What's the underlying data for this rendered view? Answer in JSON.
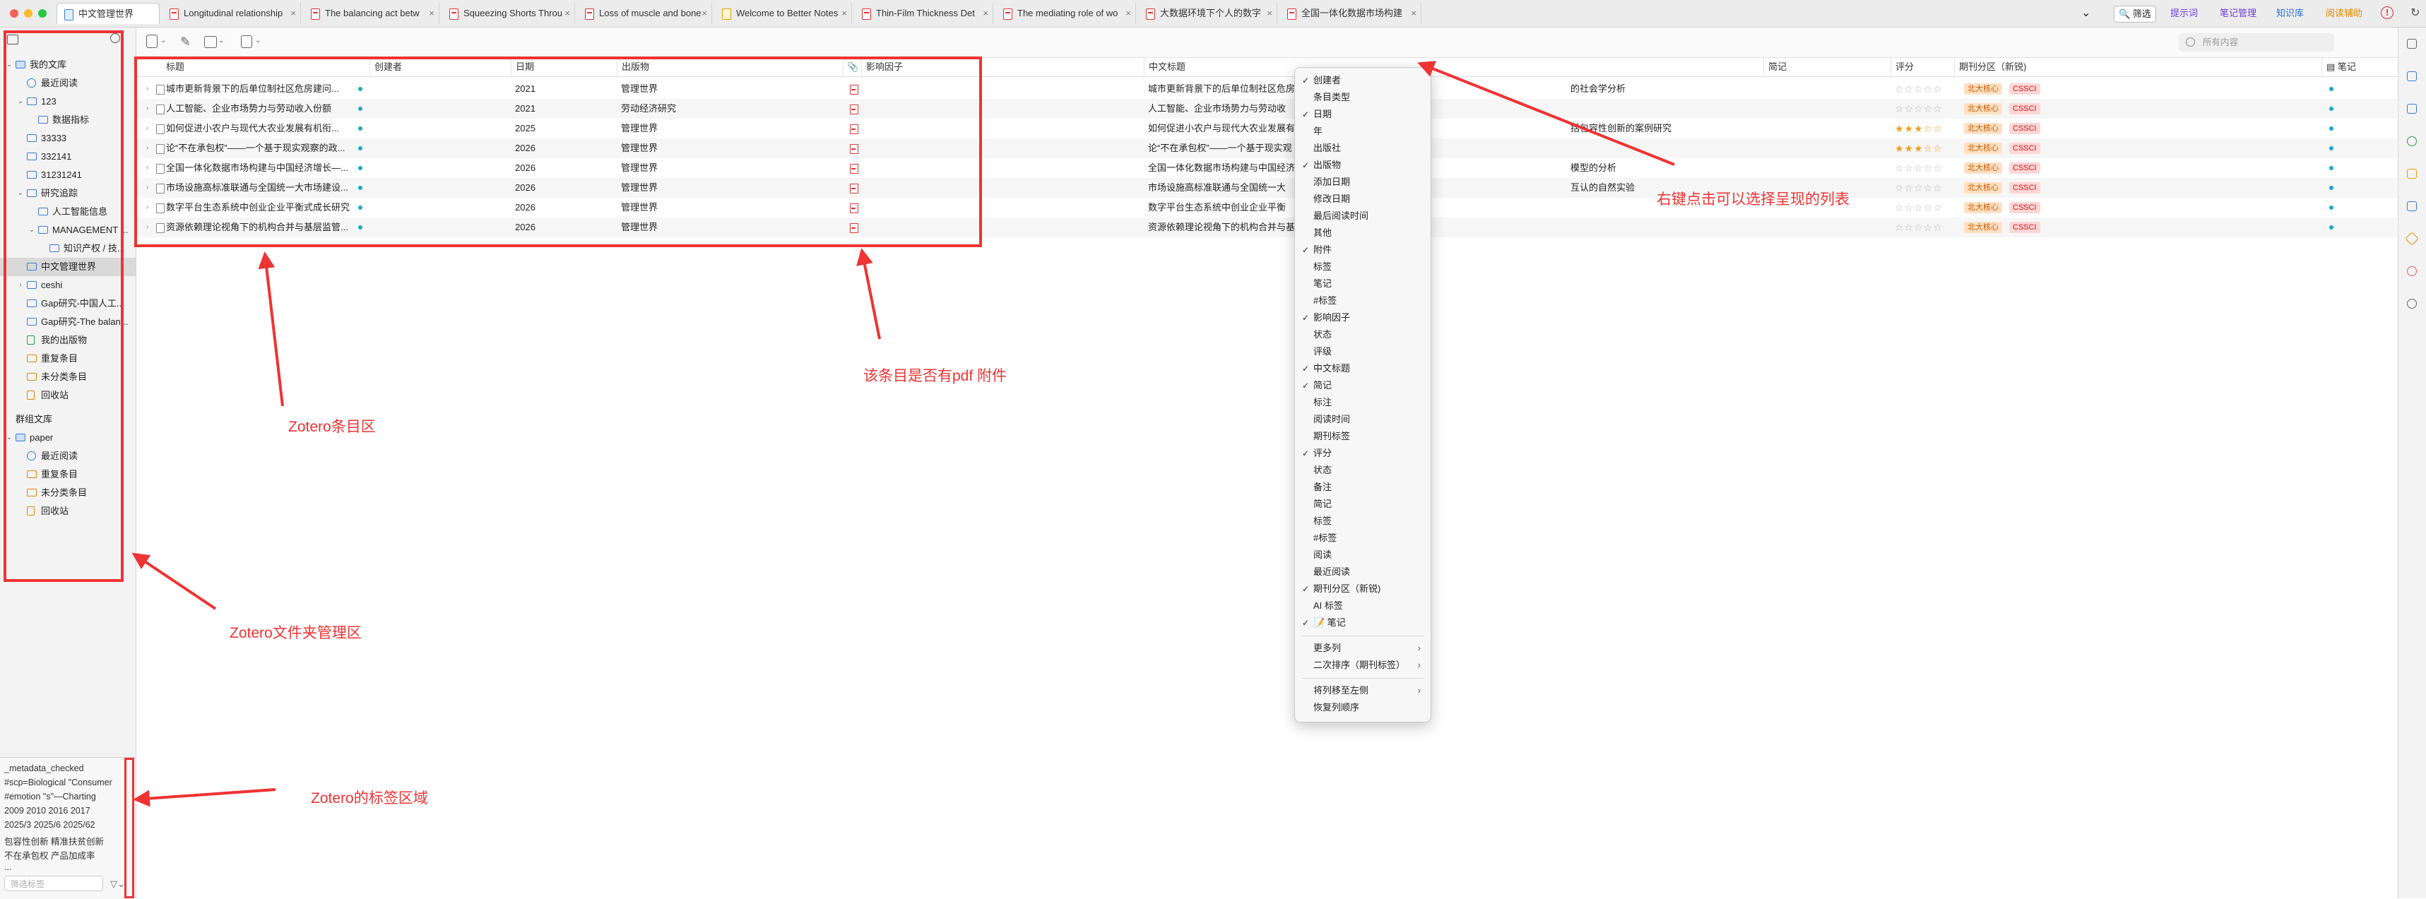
{
  "colors": {
    "annotation": "#ee3333",
    "accent": "#3a7bd5",
    "selected_row": "#d9d9d9",
    "star": "#f0a020",
    "dot": "#1aa8c7",
    "badge_orange_bg": "#ffe0c2",
    "badge_red_bg": "#ffd6d6"
  },
  "tabs": [
    {
      "label": "中文管理世界",
      "icon": "library-icon"
    },
    {
      "label": "Longitudinal relationship",
      "icon": "pdf-icon"
    },
    {
      "label": "The balancing act betw",
      "icon": "pdf-icon"
    },
    {
      "label": "Squeezing Shorts Throu",
      "icon": "pdf-icon"
    },
    {
      "label": "Loss of muscle and bone",
      "icon": "pdf-icon"
    },
    {
      "label": "Welcome to Better Notes",
      "icon": "note-icon"
    },
    {
      "label": "Thin-Film Thickness Det",
      "icon": "pdf-icon"
    },
    {
      "label": "The mediating role of wo",
      "icon": "pdf-icon"
    },
    {
      "label": "大数据环境下个人的数字",
      "icon": "pdf-icon"
    },
    {
      "label": "全国一体化数据市场构建",
      "icon": "pdf-icon"
    }
  ],
  "tab_close": "×",
  "tab_dropdown": "⌄",
  "toolbar_right": {
    "filter": "筛选",
    "prompt": "提示词",
    "notes_mgmt": "笔记管理",
    "kb": "知识库",
    "reading": "阅读辅助",
    "alert": "!",
    "sync": "↻"
  },
  "search": {
    "placeholder": "所有内容"
  },
  "library_tree": [
    {
      "label": "我的文库",
      "depth": 0,
      "twisty": "⌄",
      "icon": "library"
    },
    {
      "label": "最近阅读",
      "depth": 1,
      "twisty": "",
      "icon": "clock"
    },
    {
      "label": "123",
      "depth": 1,
      "twisty": "⌄",
      "icon": "folder"
    },
    {
      "label": "数据指标",
      "depth": 2,
      "twisty": "",
      "icon": "folder"
    },
    {
      "label": "33333",
      "depth": 1,
      "twisty": "",
      "icon": "folder"
    },
    {
      "label": "332141",
      "depth": 1,
      "twisty": "",
      "icon": "folder"
    },
    {
      "label": "31231241",
      "depth": 1,
      "twisty": "",
      "icon": "folder"
    },
    {
      "label": "研究追踪",
      "depth": 1,
      "twisty": "⌄",
      "icon": "folder"
    },
    {
      "label": "人工智能信息",
      "depth": 2,
      "twisty": "",
      "icon": "folder"
    },
    {
      "label": "MANAGEMENT ...",
      "depth": 2,
      "twisty": "⌄",
      "icon": "folder"
    },
    {
      "label": "知识产权 / 技...",
      "depth": 3,
      "twisty": "",
      "icon": "folder"
    },
    {
      "label": "中文管理世界",
      "depth": 1,
      "twisty": "",
      "icon": "folder",
      "selected": true
    },
    {
      "label": "ceshi",
      "depth": 1,
      "twisty": "›",
      "icon": "folder"
    },
    {
      "label": "Gap研究-中国人工...",
      "depth": 1,
      "twisty": "",
      "icon": "folder"
    },
    {
      "label": "Gap研究-The balan...",
      "depth": 1,
      "twisty": "",
      "icon": "folder"
    },
    {
      "label": "我的出版物",
      "depth": 1,
      "twisty": "",
      "icon": "pub"
    },
    {
      "label": "重复条目",
      "depth": 1,
      "twisty": "",
      "icon": "dup"
    },
    {
      "label": "未分类条目",
      "depth": 1,
      "twisty": "",
      "icon": "unfiled"
    },
    {
      "label": "回收站",
      "depth": 1,
      "twisty": "",
      "icon": "trash"
    },
    {
      "label": "群组文库",
      "depth": 0,
      "twisty": "",
      "icon": "none"
    },
    {
      "label": "paper",
      "depth": 0,
      "twisty": "⌄",
      "icon": "group"
    },
    {
      "label": "最近阅读",
      "depth": 1,
      "twisty": "",
      "icon": "clock"
    },
    {
      "label": "重复条目",
      "depth": 1,
      "twisty": "",
      "icon": "dup"
    },
    {
      "label": "未分类条目",
      "depth": 1,
      "twisty": "",
      "icon": "unfiled"
    },
    {
      "label": "回收站",
      "depth": 1,
      "twisty": "",
      "icon": "trash"
    }
  ],
  "tags": {
    "lines": [
      "_metadata_checked",
      "#scp=Biological  \"Consumer",
      "#emotion   \"s\"—Charting",
      "2009   2010   2016   2017",
      "2025/3   2025/6   2025/62",
      "包容性创新   精准扶贫创新",
      "不在承包权   产品加成率",
      "..."
    ],
    "filter_placeholder": "筛选标签"
  },
  "table": {
    "columns": {
      "title": "标题",
      "creator": "创建者",
      "date": "日期",
      "publication": "出版物",
      "attachment": "📎",
      "impact": "影响因子",
      "cn_title": "中文标题",
      "abstract": "简记",
      "rating": "评分",
      "journal_zone": "期刊分区（新锐)",
      "notes": "笔记"
    },
    "rows": [
      {
        "title": "城市更新背景下的后单位制社区危房建问...",
        "date": "2021",
        "publication": "管理世界",
        "cn_title": "城市更新背景下的后单位制社区危房建问...",
        "cn_tail": "的社会学分析",
        "stars": "☆☆☆☆☆",
        "rating_count": 0,
        "badges": [
          "北大核心",
          "CSSCI"
        ]
      },
      {
        "title": "人工智能、企业市场势力与劳动收入份额",
        "date": "2021",
        "publication": "劳动经济研究",
        "cn_title": "人工智能、企业市场势力与劳动收",
        "cn_tail": "",
        "stars": "☆☆☆☆☆",
        "rating_count": 0,
        "badges": [
          "北大核心",
          "CSSCI"
        ]
      },
      {
        "title": "如何促进小农户与现代大农业发展有机衔...",
        "date": "2025",
        "publication": "管理世界",
        "cn_title": "如何促进小农户与现代大农业发展有机衔",
        "cn_tail": "括包容性创新的案例研究",
        "stars": "★★★☆☆",
        "rating_count": 3,
        "badges": [
          "北大核心",
          "CSSCI"
        ]
      },
      {
        "title": "论“不在承包权”——一个基于现实观察的政...",
        "date": "2026",
        "publication": "管理世界",
        "cn_title": "论“不在承包权”——一个基于现实观",
        "cn_tail": "",
        "stars": "★★★☆☆",
        "rating_count": 3,
        "badges": [
          "北大核心",
          "CSSCI"
        ]
      },
      {
        "title": "全国一体化数据市场构建与中国经济增长—...",
        "date": "2026",
        "publication": "管理世界",
        "cn_title": "全国一体化数据市场构建与中国经济",
        "cn_tail": "模型的分析",
        "stars": "☆☆☆☆☆",
        "rating_count": 0,
        "badges": [
          "北大核心",
          "CSSCI"
        ]
      },
      {
        "title": "市场设施高标准联通与全国统一大市场建设...",
        "date": "2026",
        "publication": "管理世界",
        "cn_title": "市场设施高标准联通与全国统一大",
        "cn_tail": "互认的自然实验",
        "stars": "☆☆☆☆☆",
        "rating_count": 0,
        "badges": [
          "北大核心",
          "CSSCI"
        ]
      },
      {
        "title": "数字平台生态系统中创业企业平衡式成长研究",
        "date": "2026",
        "publication": "管理世界",
        "cn_title": "数字平台生态系统中创业企业平衡",
        "cn_tail": "",
        "stars": "☆☆☆☆☆",
        "rating_count": 0,
        "badges": [
          "北大核心",
          "CSSCI"
        ]
      },
      {
        "title": "资源依赖理论视角下的机构合并与基层监管...",
        "date": "2026",
        "publication": "管理世界",
        "cn_title": "资源依赖理论视角下的机构合并与基",
        "cn_tail": "",
        "stars": "☆☆☆☆☆",
        "rating_count": 0,
        "badges": [
          "北大核心",
          "CSSCI"
        ]
      }
    ]
  },
  "context_menu": {
    "items": [
      {
        "label": "创建者",
        "checked": true
      },
      {
        "label": "条目类型",
        "checked": false
      },
      {
        "label": "日期",
        "checked": true
      },
      {
        "label": "年",
        "checked": false
      },
      {
        "label": "出版社",
        "checked": false
      },
      {
        "label": "出版物",
        "checked": true
      },
      {
        "label": "添加日期",
        "checked": false
      },
      {
        "label": "修改日期",
        "checked": false
      },
      {
        "label": "最后阅读时间",
        "checked": false
      },
      {
        "label": "其他",
        "checked": false
      },
      {
        "label": "附件",
        "checked": true
      },
      {
        "label": "标签",
        "checked": false
      },
      {
        "label": "笔记",
        "checked": false
      },
      {
        "label": "#标签",
        "checked": false
      },
      {
        "label": "影响因子",
        "checked": true
      },
      {
        "label": "状态",
        "checked": false
      },
      {
        "label": "评级",
        "checked": false
      },
      {
        "label": "中文标题",
        "checked": true
      },
      {
        "label": "简记",
        "checked": true
      },
      {
        "label": "标注",
        "checked": false
      },
      {
        "label": "阅读时间",
        "checked": false
      },
      {
        "label": "期刊标签",
        "checked": false
      },
      {
        "label": "评分",
        "checked": true
      },
      {
        "label": "状态",
        "checked": false
      },
      {
        "label": "备注",
        "checked": false
      },
      {
        "label": "简记",
        "checked": false
      },
      {
        "label": "标签",
        "checked": false
      },
      {
        "label": "#标签",
        "checked": false
      },
      {
        "label": "阅读",
        "checked": false
      },
      {
        "label": "最近阅读",
        "checked": false
      },
      {
        "label": "期刊分区（新锐)",
        "checked": true
      },
      {
        "label": "AI 标签",
        "checked": false
      },
      {
        "label": "📝 笔记",
        "checked": true
      }
    ],
    "more_columns": "更多列",
    "secondary_sort": "二次排序（期刊标签）",
    "move_left": "将列移至左侧",
    "restore": "恢复列顺序",
    "check_mark": "✓",
    "submenu_arrow": "›"
  },
  "annotations": {
    "items_area": "Zotero条目区",
    "folders_area": "Zotero文件夹管理区",
    "tags_area": "Zotero的标签区域",
    "pdf_attach": "该条目是否有pdf 附件",
    "right_click": "右键点击可以选择呈现的列表"
  }
}
